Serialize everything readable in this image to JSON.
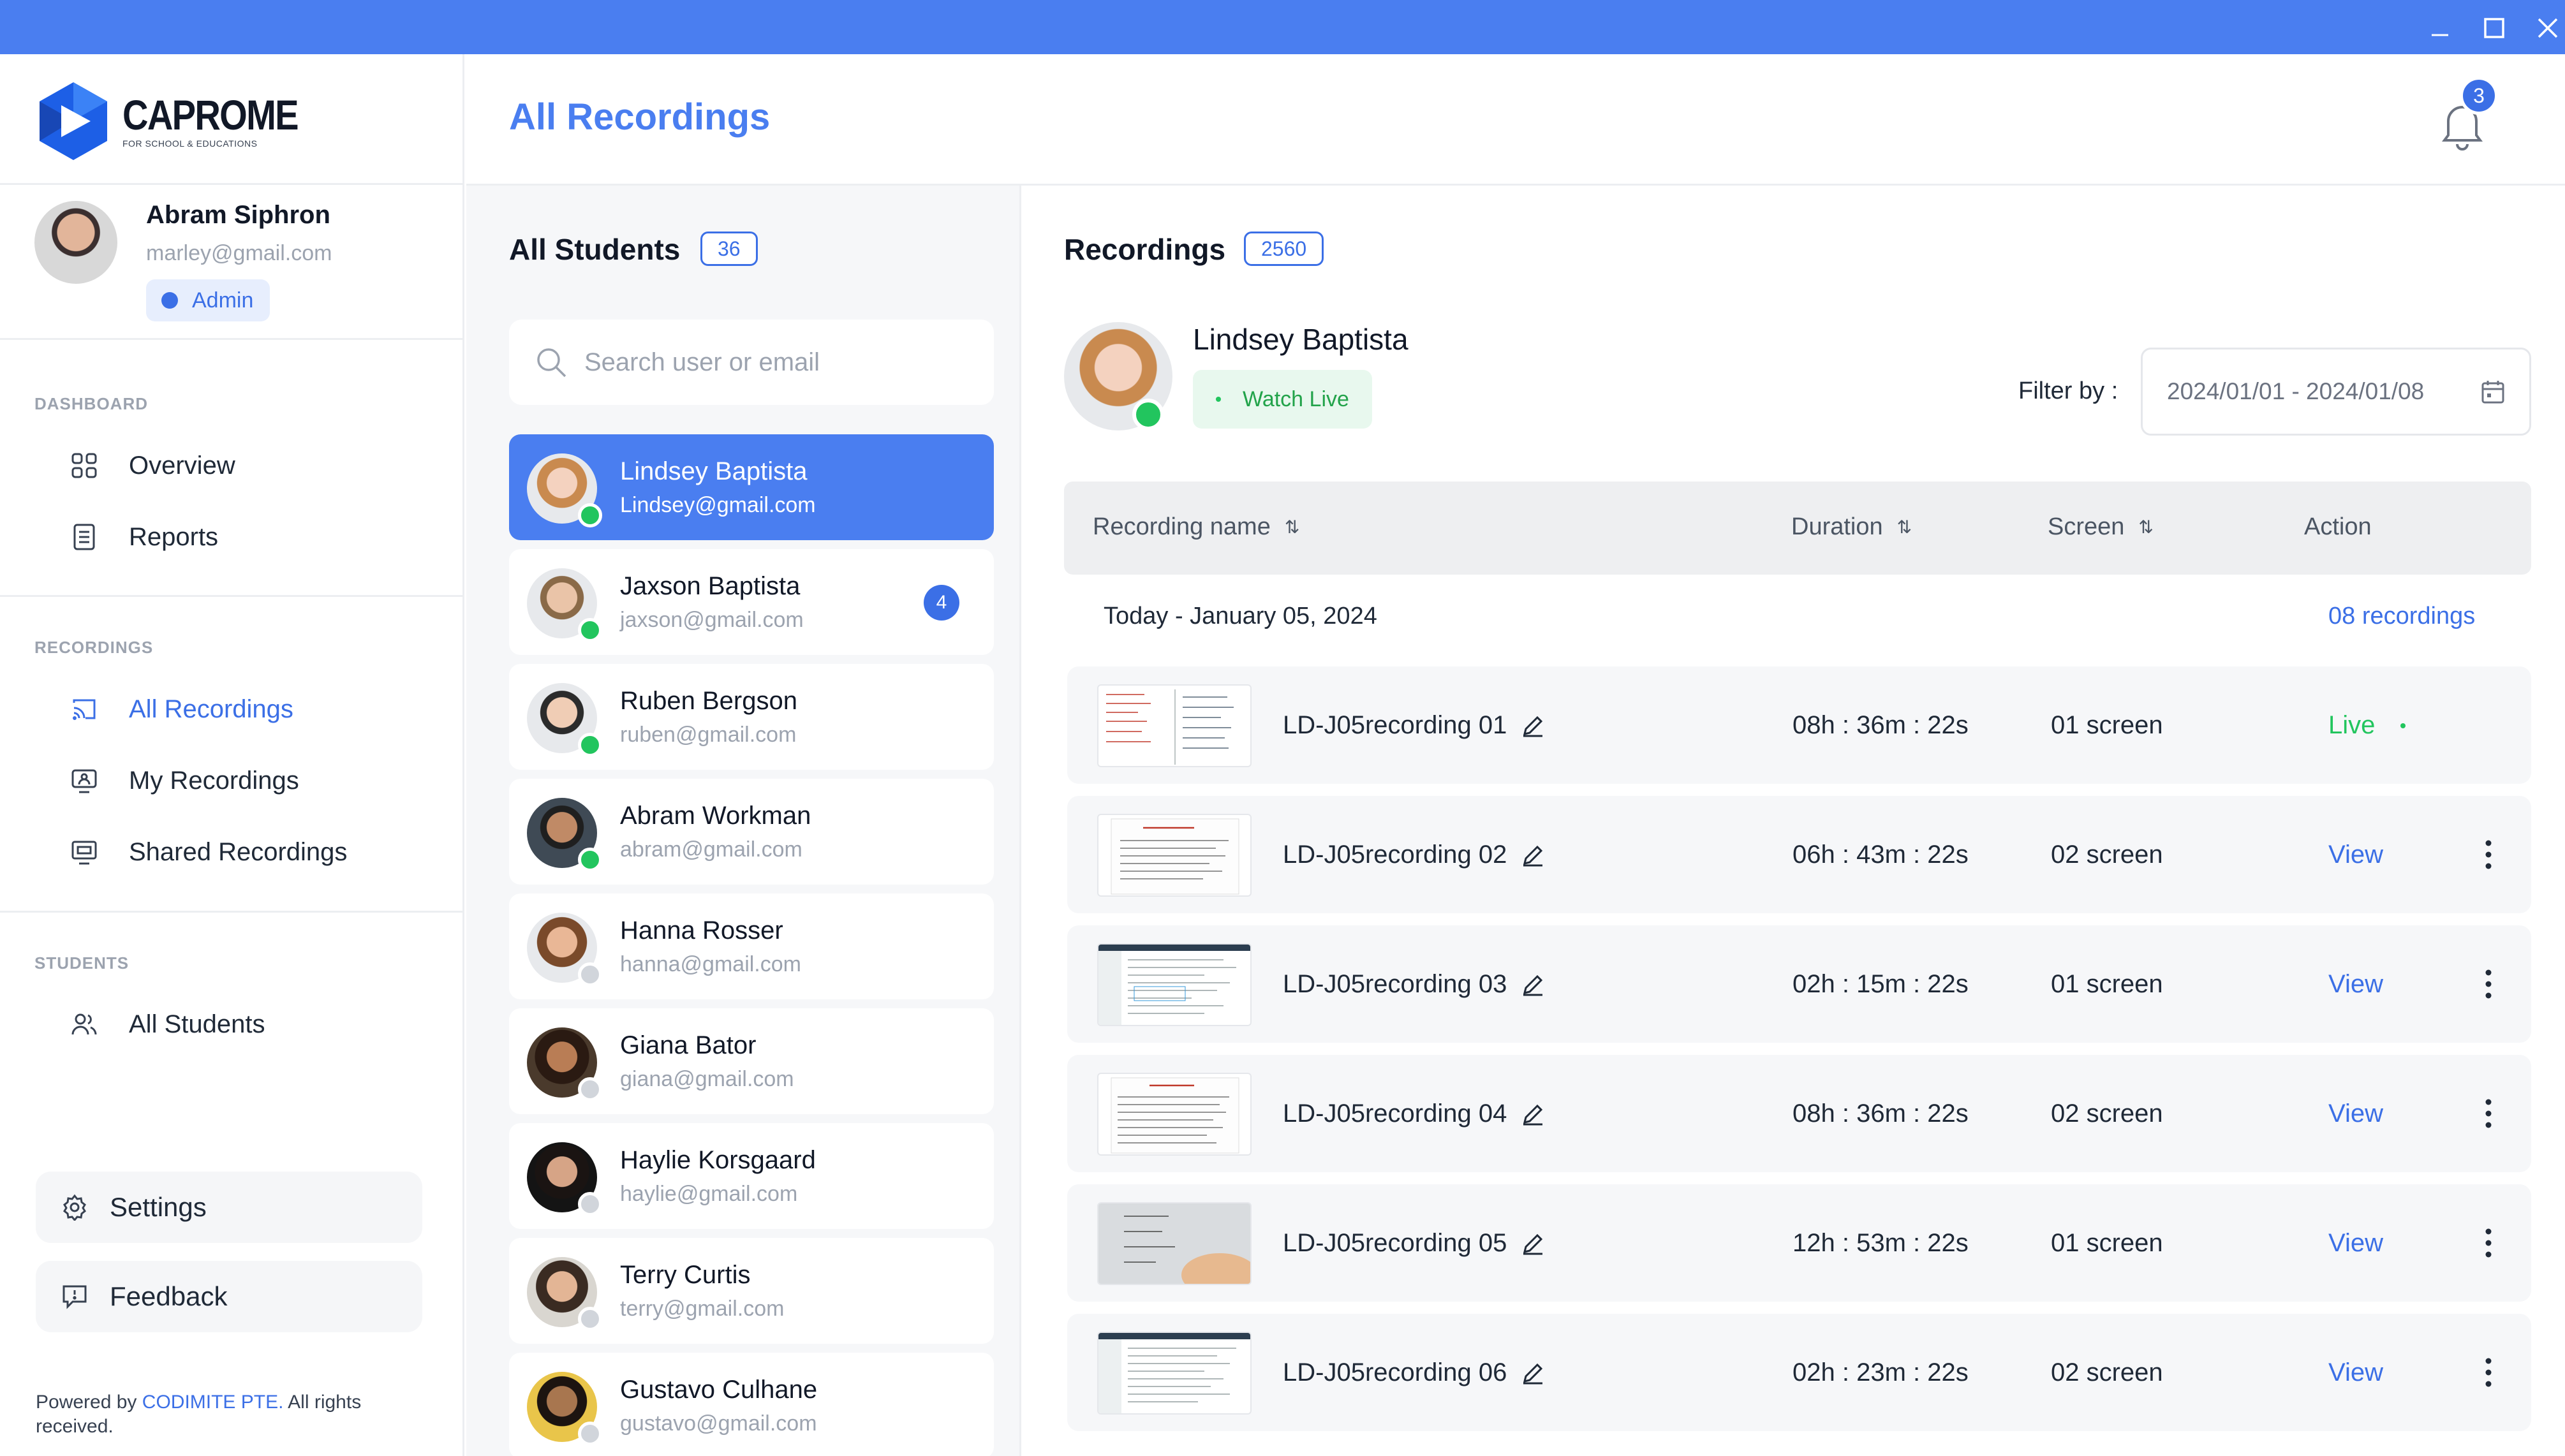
{
  "window": {
    "minimize_icon": "minimize-icon",
    "maximize_icon": "maximize-icon",
    "close_icon": "close-icon"
  },
  "brand": {
    "name": "CAPROME",
    "tagline": "FOR SCHOOL & EDUCATIONS"
  },
  "profile": {
    "name": "Abram Siphron",
    "email": "marley@gmail.com",
    "role": "Admin"
  },
  "sidebar": {
    "sections": [
      {
        "label": "DASHBOARD",
        "items": [
          {
            "label": "Overview",
            "icon": "grid-icon"
          },
          {
            "label": "Reports",
            "icon": "document-icon"
          }
        ]
      },
      {
        "label": "RECORDINGS",
        "items": [
          {
            "label": "All Recordings",
            "icon": "cast-icon",
            "active": true
          },
          {
            "label": "My Recordings",
            "icon": "user-screen-icon"
          },
          {
            "label": "Shared Recordings",
            "icon": "screen-icon"
          }
        ]
      },
      {
        "label": "STUDENTS",
        "items": [
          {
            "label": "All Students",
            "icon": "users-icon"
          }
        ]
      }
    ],
    "settings_label": "Settings",
    "feedback_label": "Feedback",
    "powered_prefix": "Powered by",
    "powered_brand": "CODIMITE PTE.",
    "powered_suffix": "All rights received."
  },
  "header": {
    "title": "All Recordings",
    "notification_count": "3"
  },
  "students": {
    "title": "All Students",
    "count": "36",
    "search_placeholder": "Search user or email",
    "list": [
      {
        "name": "Lindsey Baptista",
        "email": "Lindsey@gmail.com",
        "online": true,
        "selected": true
      },
      {
        "name": "Jaxson Baptista",
        "email": "jaxson@gmail.com",
        "online": true,
        "unread": "4"
      },
      {
        "name": "Ruben Bergson",
        "email": "ruben@gmail.com",
        "online": true
      },
      {
        "name": "Abram Workman",
        "email": "abram@gmail.com",
        "online": true
      },
      {
        "name": "Hanna Rosser",
        "email": "hanna@gmail.com",
        "online": false
      },
      {
        "name": "Giana Bator",
        "email": "giana@gmail.com",
        "online": false
      },
      {
        "name": "Haylie Korsgaard",
        "email": "haylie@gmail.com",
        "online": false
      },
      {
        "name": "Terry Curtis",
        "email": "terry@gmail.com",
        "online": false
      },
      {
        "name": "Gustavo Culhane",
        "email": "gustavo@gmail.com",
        "online": false
      }
    ]
  },
  "recordings": {
    "title": "Recordings",
    "count": "2560",
    "student_name": "Lindsey Baptista",
    "watch_live_label": "Watch Live",
    "filter_label": "Filter by :",
    "filter_value": "2024/01/01 - 2024/01/08",
    "columns": [
      "Recording name",
      "Duration",
      "Screen",
      "Action"
    ],
    "group_label": "Today - January 05, 2024",
    "group_count": "08 recordings",
    "rows": [
      {
        "name": "LD-J05recording 01",
        "duration": "08h : 36m : 22s",
        "screen": "01 screen",
        "action": "Live"
      },
      {
        "name": "LD-J05recording 02",
        "duration": "06h : 43m : 22s",
        "screen": "02 screen",
        "action": "View"
      },
      {
        "name": "LD-J05recording 03",
        "duration": "02h : 15m : 22s",
        "screen": "01 screen",
        "action": "View"
      },
      {
        "name": "LD-J05recording 04",
        "duration": "08h : 36m : 22s",
        "screen": "02 screen",
        "action": "View"
      },
      {
        "name": "LD-J05recording 05",
        "duration": "12h : 53m : 22s",
        "screen": "01 screen",
        "action": "View"
      },
      {
        "name": "LD-J05recording 06",
        "duration": "02h : 23m : 22s",
        "screen": "02 screen",
        "action": "View"
      }
    ]
  },
  "colors": {
    "accent": "#4a7ef0",
    "online": "#22c55e",
    "offline": "#d1d5db"
  }
}
